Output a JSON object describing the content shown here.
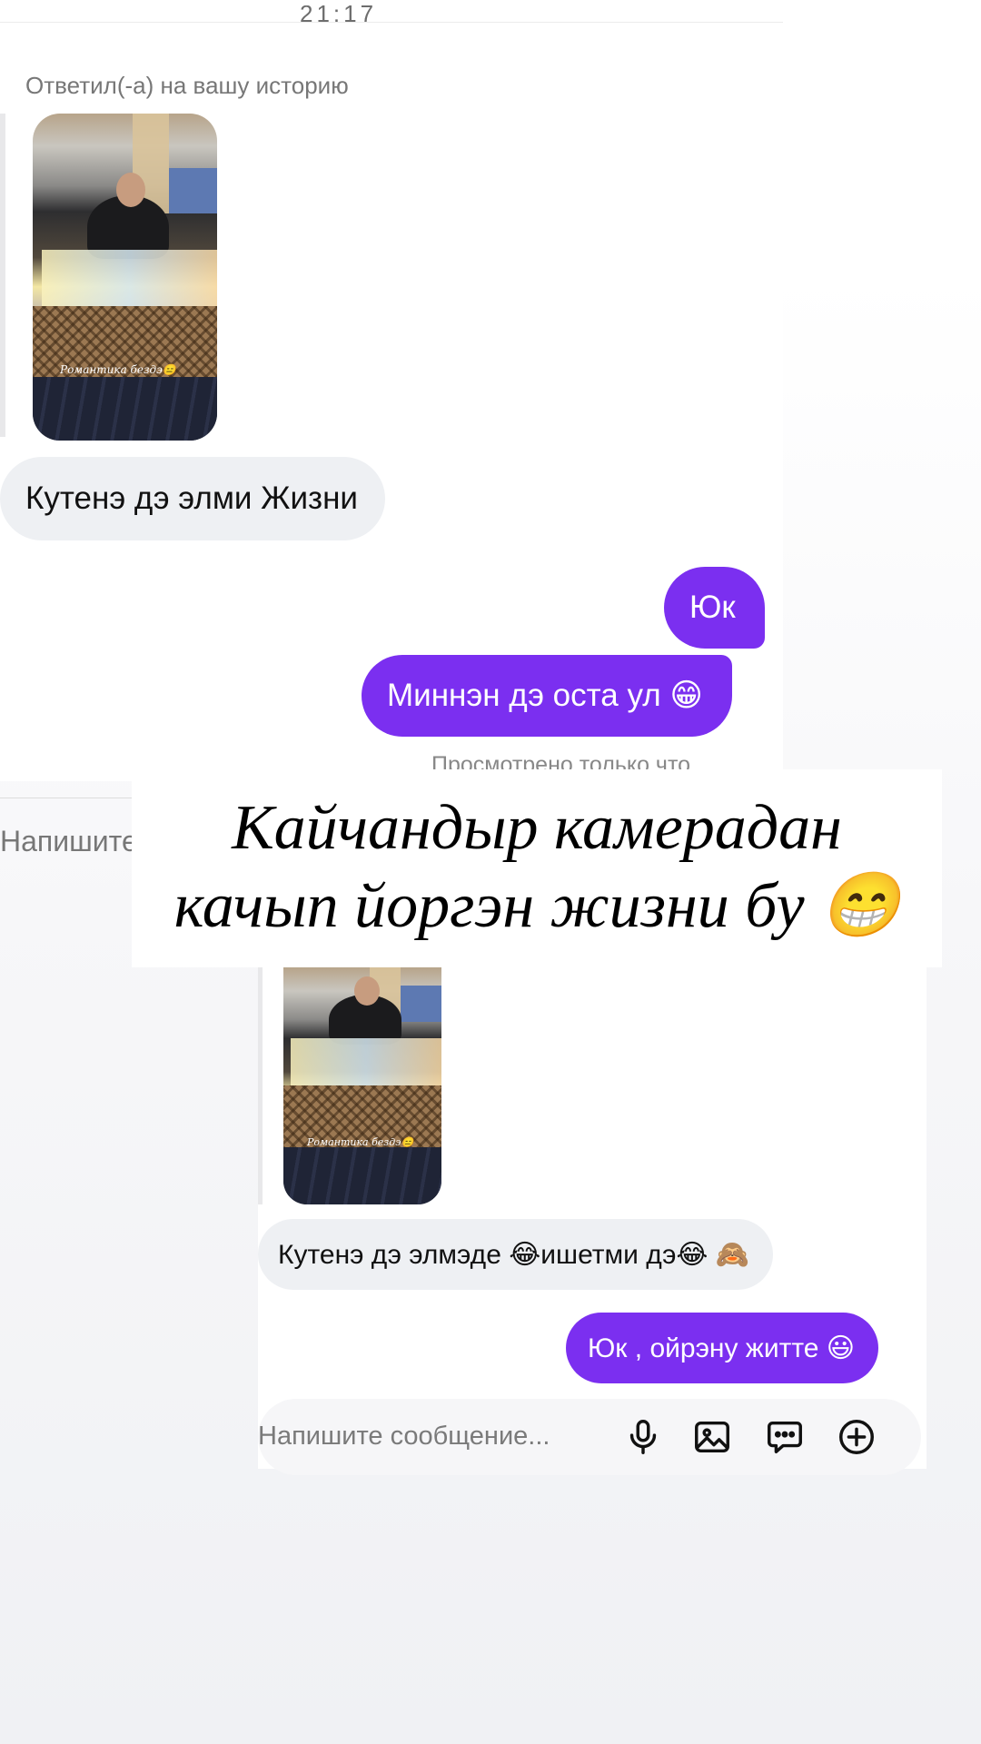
{
  "chat_top": {
    "clock_fragment": "21:17",
    "reply_note": "Ответил(-а) на вашу историю",
    "story_caption": "Романтика бездэ😑",
    "messages": [
      {
        "text": "Кутенэ дэ элми Жизни",
        "direction": "incoming"
      },
      {
        "text": "Юк",
        "direction": "outgoing"
      },
      {
        "text": "Миннэн дэ оста ул 😁",
        "direction": "outgoing"
      }
    ],
    "seen_status": "Просмотрено только что",
    "composer_cut_placeholder": "Напишите сообщение..."
  },
  "overlay_caption": {
    "line1": "Кайчандыр камерадан",
    "line2": "качып йоргэн жизни бу 😁"
  },
  "chat_bottom": {
    "story_caption": "Романтика бездэ😑",
    "messages": [
      {
        "text": "Кутенэ дэ элмэде 😂ишетми дэ😂 🙈",
        "direction": "incoming"
      },
      {
        "text": "Юк , ойрэну житте 😃",
        "direction": "outgoing"
      }
    ],
    "composer": {
      "placeholder": "Напишите сообщение...",
      "icons": [
        "microphone-icon",
        "image-icon",
        "chat-icon",
        "plus-circle-icon"
      ]
    }
  },
  "colors": {
    "outgoing_bubble": "#7b2ff0",
    "incoming_bubble": "#eef0f3",
    "background": "#ffffff"
  }
}
